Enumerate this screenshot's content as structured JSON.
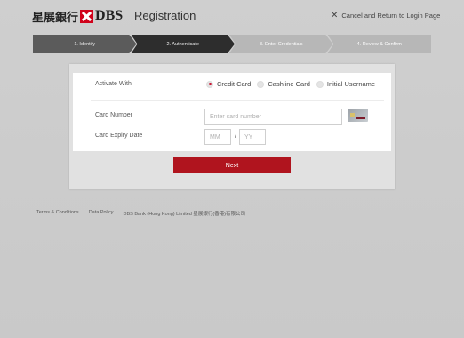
{
  "header": {
    "logo_cn": "星展銀行",
    "logo_en": "DBS",
    "page_title": "Registration",
    "cancel_icon": "close-icon",
    "cancel_label": "Cancel and Return to Login Page"
  },
  "steps": [
    {
      "label": "1. Identify",
      "state": "done"
    },
    {
      "label": "2. Authenticate",
      "state": "active"
    },
    {
      "label": "3. Enter Credentials",
      "state": "pending"
    },
    {
      "label": "4. Review & Confirm",
      "state": "pending"
    }
  ],
  "form": {
    "activate_label": "Activate With",
    "options": [
      {
        "label": "Credit Card",
        "selected": true
      },
      {
        "label": "Cashline Card",
        "selected": false
      },
      {
        "label": "Initial Username",
        "selected": false
      }
    ],
    "card_number_label": "Card Number",
    "card_number_placeholder": "Enter card number",
    "card_number_value": "",
    "expiry_label": "Card Expiry Date",
    "expiry_month_placeholder": "MM",
    "expiry_year_placeholder": "YY",
    "expiry_separator": "/",
    "card_icon": "credit-card-icon",
    "next_label": "Next"
  },
  "footer": {
    "links": [
      "Terms & Conditions",
      "Data Policy",
      "DBS Bank (Hong Kong) Limited 星展銀行(香港)有限公司"
    ]
  },
  "colors": {
    "accent": "#b0141e",
    "brand_red": "#d0021b",
    "step_active": "#2d2d2d",
    "step_done": "#5b5b5b",
    "step_pending": "#b7b7b7"
  }
}
